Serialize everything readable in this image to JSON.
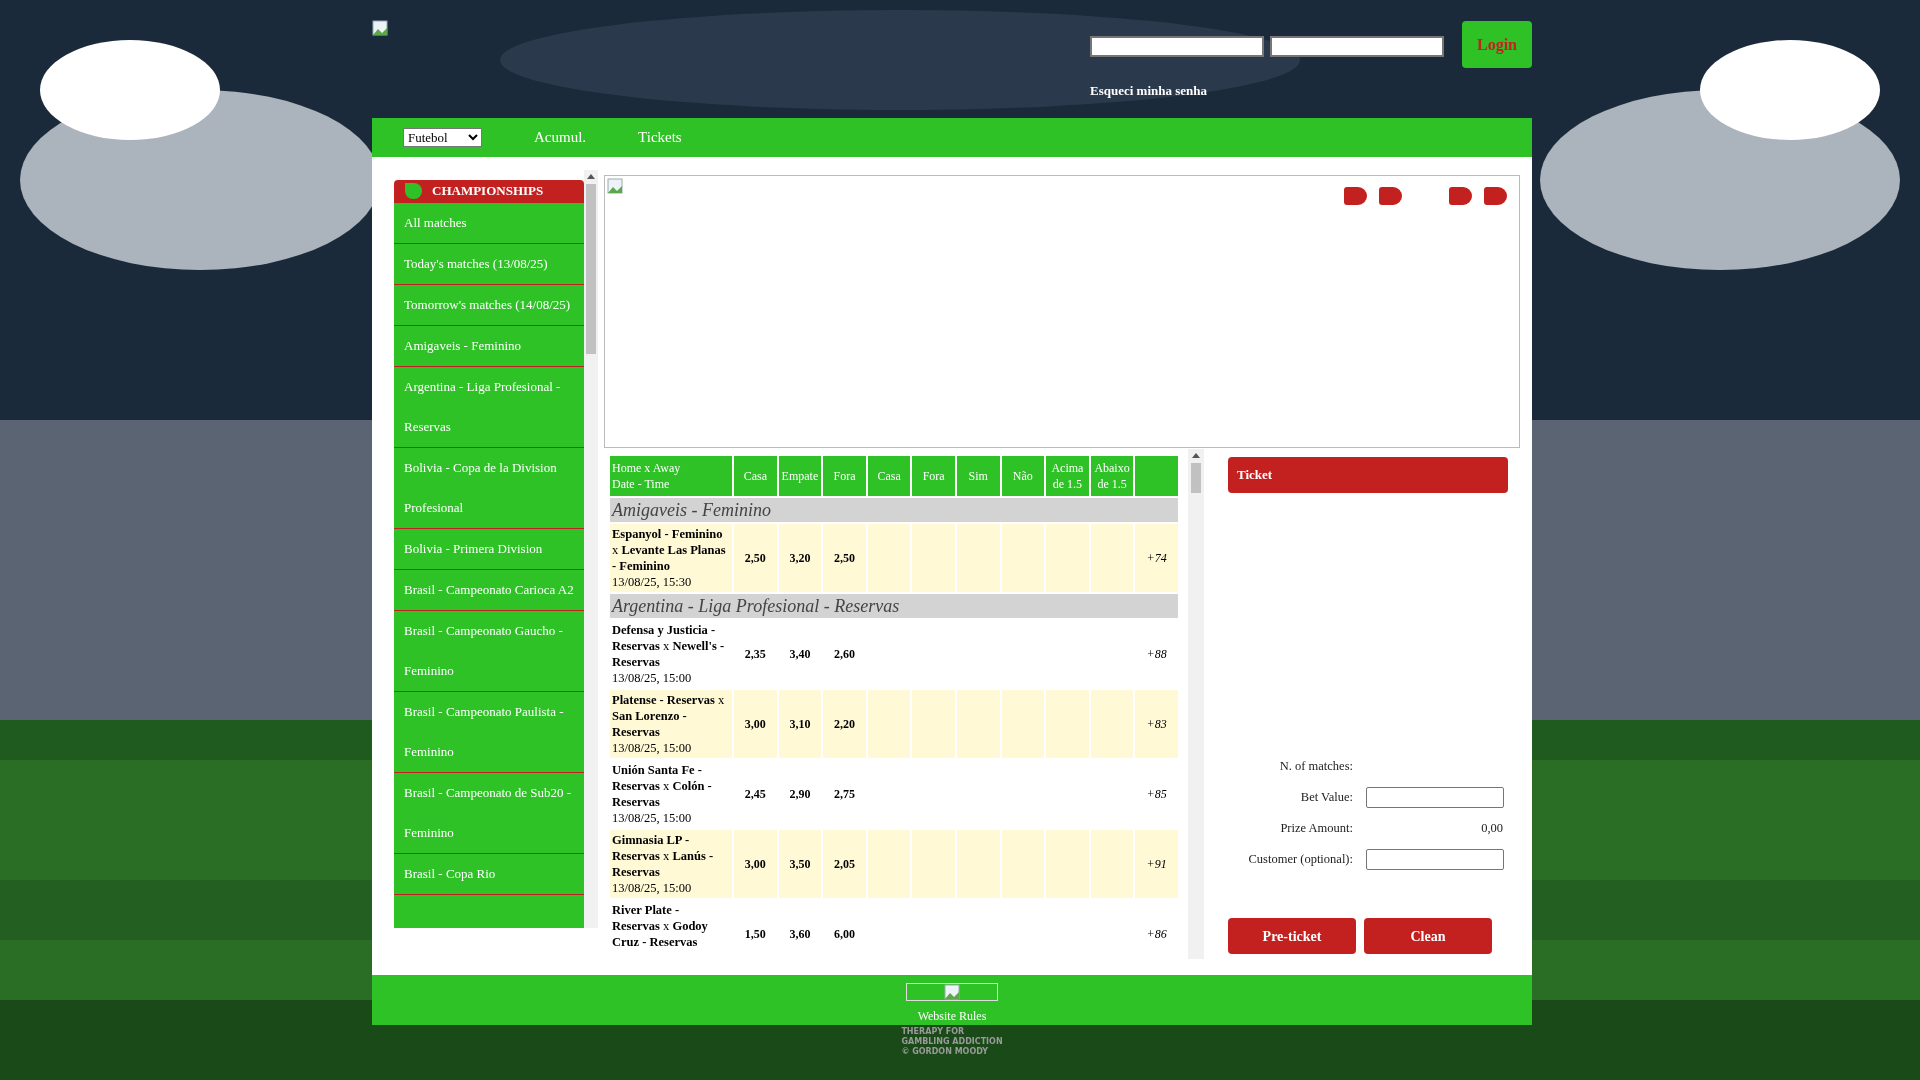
{
  "header": {
    "forgot_password": "Esqueci minha senha",
    "login_button": "Login"
  },
  "nav": {
    "sport_select": "Futebol",
    "links": [
      "Acumul.",
      "Tickets"
    ]
  },
  "sidebar": {
    "title": "CHAMPIONSHIPS",
    "items": [
      {
        "label": "All matches"
      },
      {
        "label": "Today's matches (13/08/25)"
      },
      {
        "label": "Tomorrow's matches (14/08/25)"
      },
      {
        "label": "Amigaveis - Feminino"
      },
      {
        "label": "Argentina - Liga Profesional - Reservas"
      },
      {
        "label": "Bolivia - Copa de la Division Profesional"
      },
      {
        "label": "Bolivia - Primera Division"
      },
      {
        "label": "Brasil - Campeonato Carioca A2"
      },
      {
        "label": "Brasil - Campeonato Gaucho - Feminino"
      },
      {
        "label": "Brasil - Campeonato Paulista - Feminino"
      },
      {
        "label": "Brasil - Campeonato de Sub20 - Feminino"
      },
      {
        "label": "Brasil - Copa Rio"
      }
    ]
  },
  "table": {
    "header_first": [
      "Home x Away",
      "Date - Time"
    ],
    "columns": [
      "Casa",
      "Empate",
      "Fora",
      "Casa",
      "Fora",
      "Sim",
      "Não",
      "Acima de 1.5",
      "Abaixo de 1.5"
    ],
    "groups": [
      {
        "name": "Amigaveis - Feminino",
        "matches": [
          {
            "teams": "**Espanyol - Feminino** x **Levante Las Planas - Feminino**",
            "date": "13/08/25, 15:30",
            "odds": [
              "2,50",
              "3,20",
              "2,50"
            ],
            "more": "+74"
          }
        ]
      },
      {
        "name": "Argentina - Liga Profesional - Reservas",
        "matches": [
          {
            "teams": "**Defensa y Justicia - Reservas** x **Newell's - Reservas**",
            "date": "13/08/25, 15:00",
            "odds": [
              "2,35",
              "3,40",
              "2,60"
            ],
            "more": "+88"
          },
          {
            "teams": "**Platense - Reservas** x **San Lorenzo - Reservas**",
            "date": "13/08/25, 15:00",
            "odds": [
              "3,00",
              "3,10",
              "2,20"
            ],
            "more": "+83"
          },
          {
            "teams": "**Unión Santa Fe - Reservas** x **Colón - Reservas**",
            "date": "13/08/25, 15:00",
            "odds": [
              "2,45",
              "2,90",
              "2,75"
            ],
            "more": "+85"
          },
          {
            "teams": "**Gimnasia LP - Reservas** x **Lanús - Reservas**",
            "date": "13/08/25, 15:00",
            "odds": [
              "3,00",
              "3,50",
              "2,05"
            ],
            "more": "+91"
          },
          {
            "teams": "**River Plate - Reservas** x **Godoy Cruz - Reservas**",
            "odds": [
              "1,50",
              "3,60",
              "6,00"
            ],
            "more": "+86"
          }
        ]
      }
    ]
  },
  "ticket": {
    "title": "Ticket",
    "fields": [
      {
        "label": "N. of matches:",
        "kind": "text"
      },
      {
        "label": "Bet Value:",
        "kind": "input"
      },
      {
        "label": "Prize Amount:",
        "kind": "text",
        "value": "0,00"
      },
      {
        "label": "Customer (optional):",
        "kind": "input"
      }
    ],
    "buttons": [
      "Pre-ticket",
      "Clean"
    ]
  },
  "footer": {
    "rules_link": "Website Rules",
    "gambling_logo": [
      "THERAPY FOR",
      "GAMBLING ADDICTION",
      "© GORDON MOODY"
    ]
  }
}
